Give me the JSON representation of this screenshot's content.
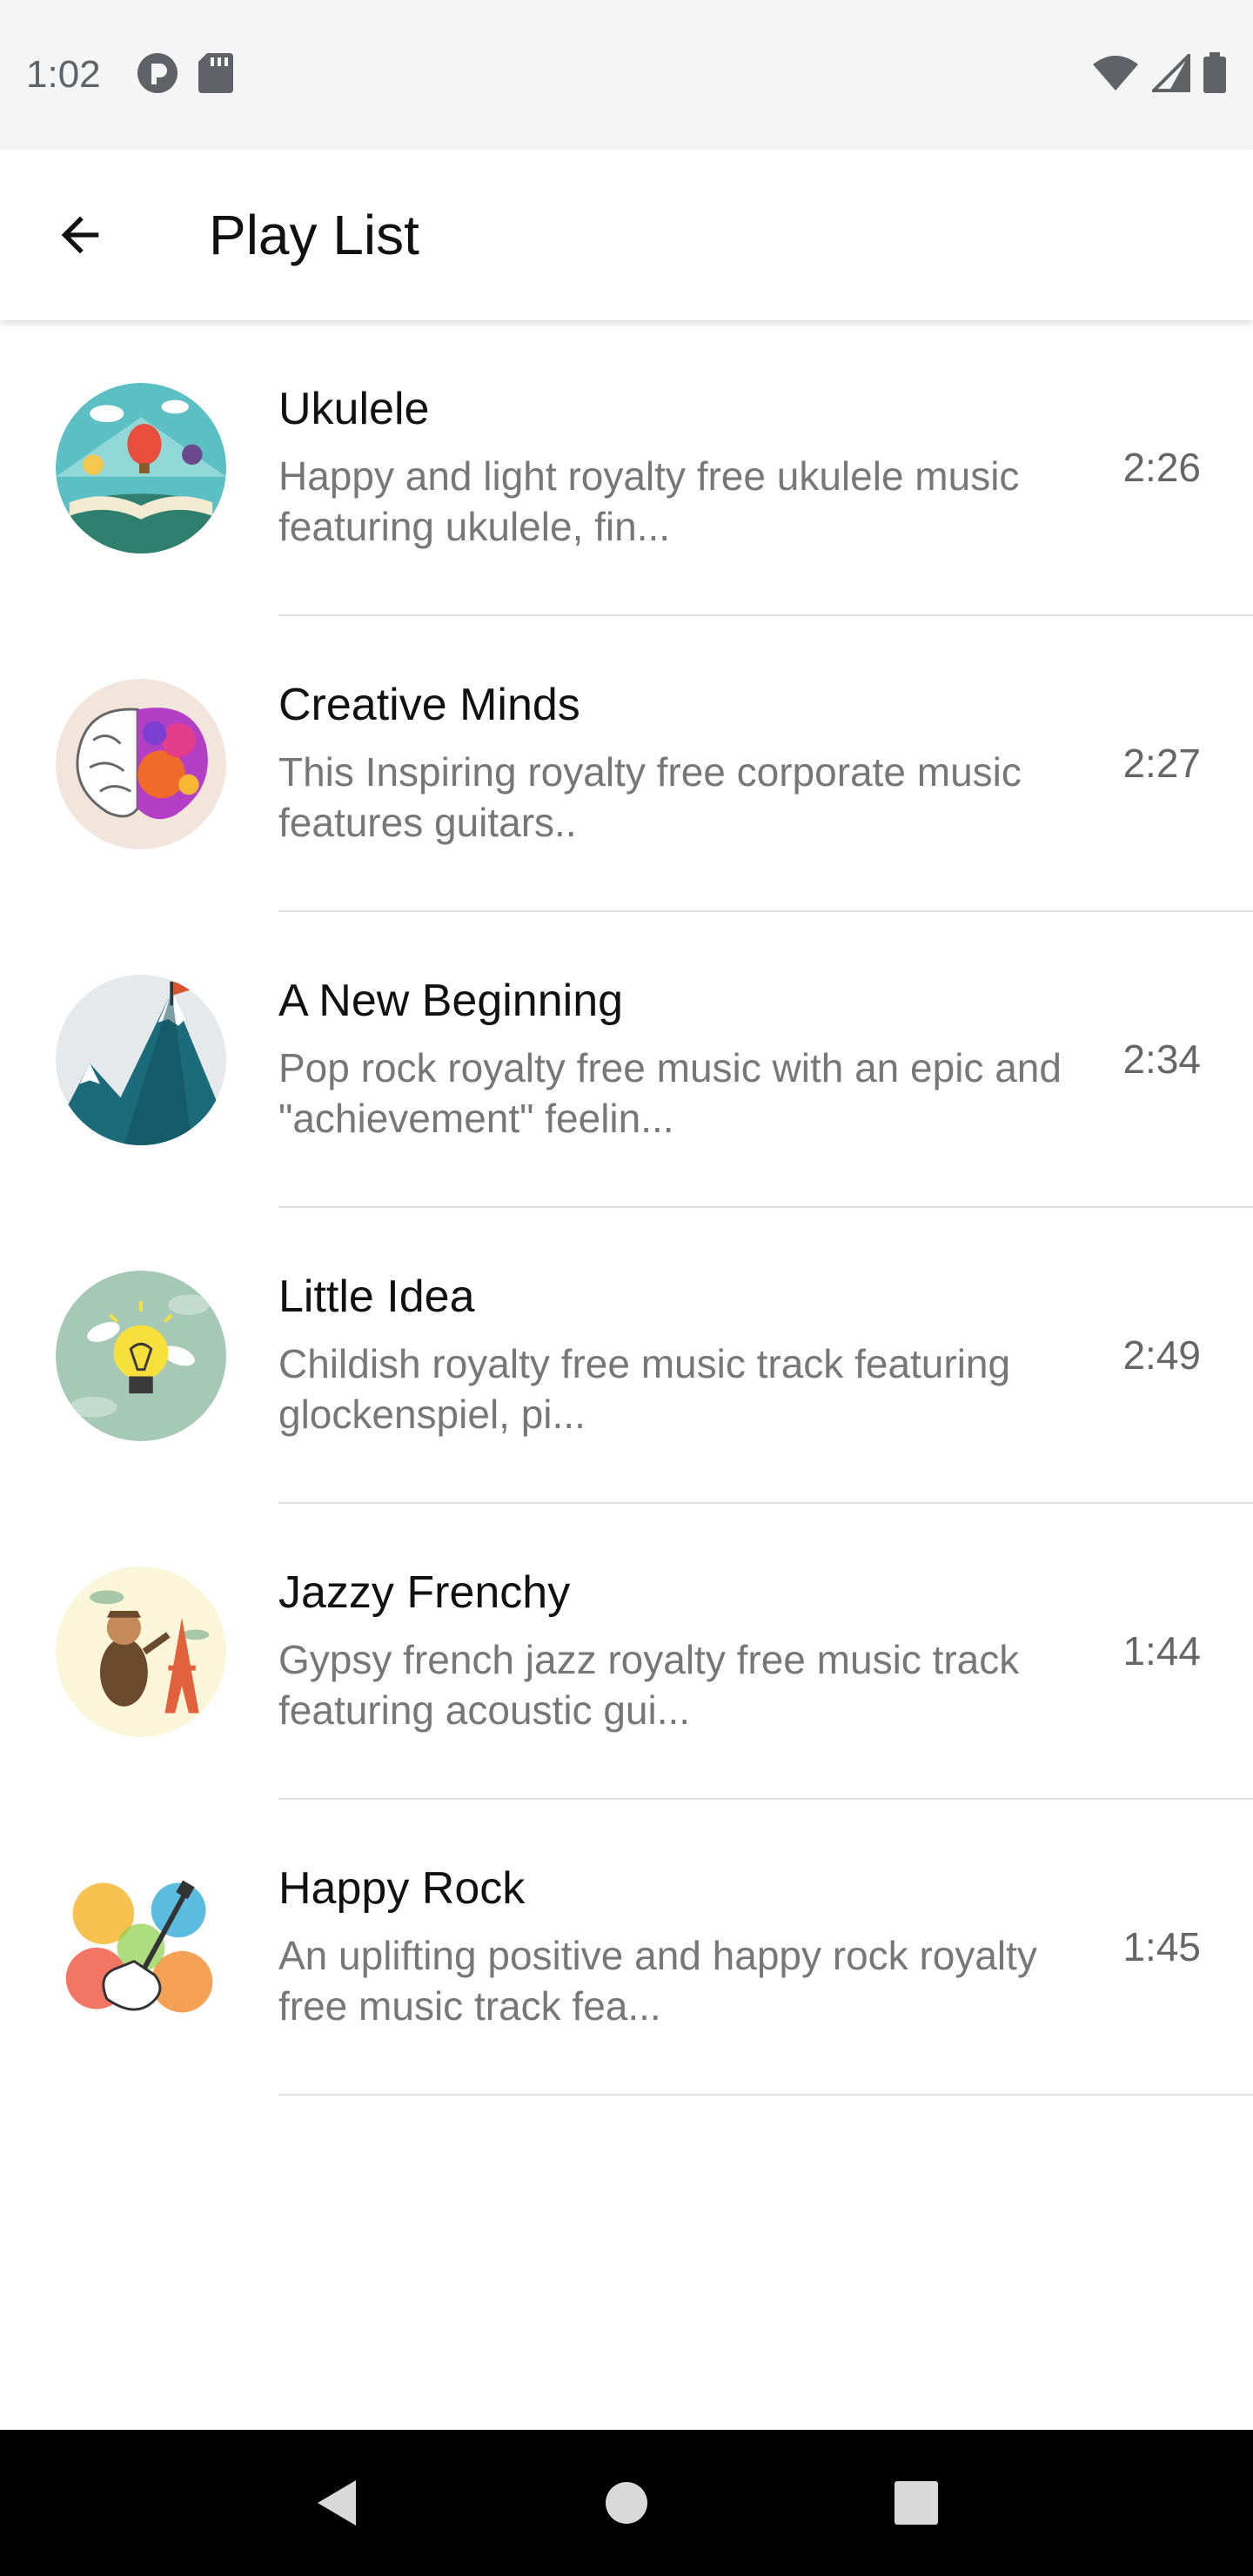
{
  "status_bar": {
    "time": "1:02",
    "left_icons": [
      "app-notification-icon",
      "sd-card-icon"
    ],
    "right_icons": [
      "wifi-icon",
      "cell-signal-icon",
      "battery-icon"
    ]
  },
  "app_bar": {
    "back_icon": "arrow-back-icon",
    "title": "Play List"
  },
  "tracks": [
    {
      "title": "Ukulele",
      "description": "Happy and light royalty free ukulele music featuring ukulele, fin...",
      "duration": "2:26",
      "artwork": "ukulele-artwork"
    },
    {
      "title": "Creative Minds",
      "description": "This Inspiring royalty free corporate music features guitars..",
      "duration": "2:27",
      "artwork": "creative-minds-artwork"
    },
    {
      "title": "A New Beginning",
      "description": "Pop rock royalty free music with an epic and \"achievement\" feelin...",
      "duration": "2:34",
      "artwork": "new-beginning-artwork"
    },
    {
      "title": "Little Idea",
      "description": "Childish royalty free music track featuring glockenspiel, pi...",
      "duration": "2:49",
      "artwork": "little-idea-artwork"
    },
    {
      "title": "Jazzy Frenchy",
      "description": "Gypsy french jazz royalty free music track featuring acoustic gui...",
      "duration": "1:44",
      "artwork": "jazzy-frenchy-artwork"
    },
    {
      "title": "Happy Rock",
      "description": "An uplifting positive and happy rock royalty free music track fea...",
      "duration": "1:45",
      "artwork": "happy-rock-artwork"
    }
  ],
  "nav_bar": {
    "buttons": [
      "back-triangle-icon",
      "home-circle-icon",
      "recents-square-icon"
    ]
  },
  "colors": {
    "status_bar_bg": "#f5f5f5",
    "title_text": "#111111",
    "subtitle_text": "#777777",
    "divider": "#e2e2e2",
    "nav_bar_bg": "#000000"
  }
}
